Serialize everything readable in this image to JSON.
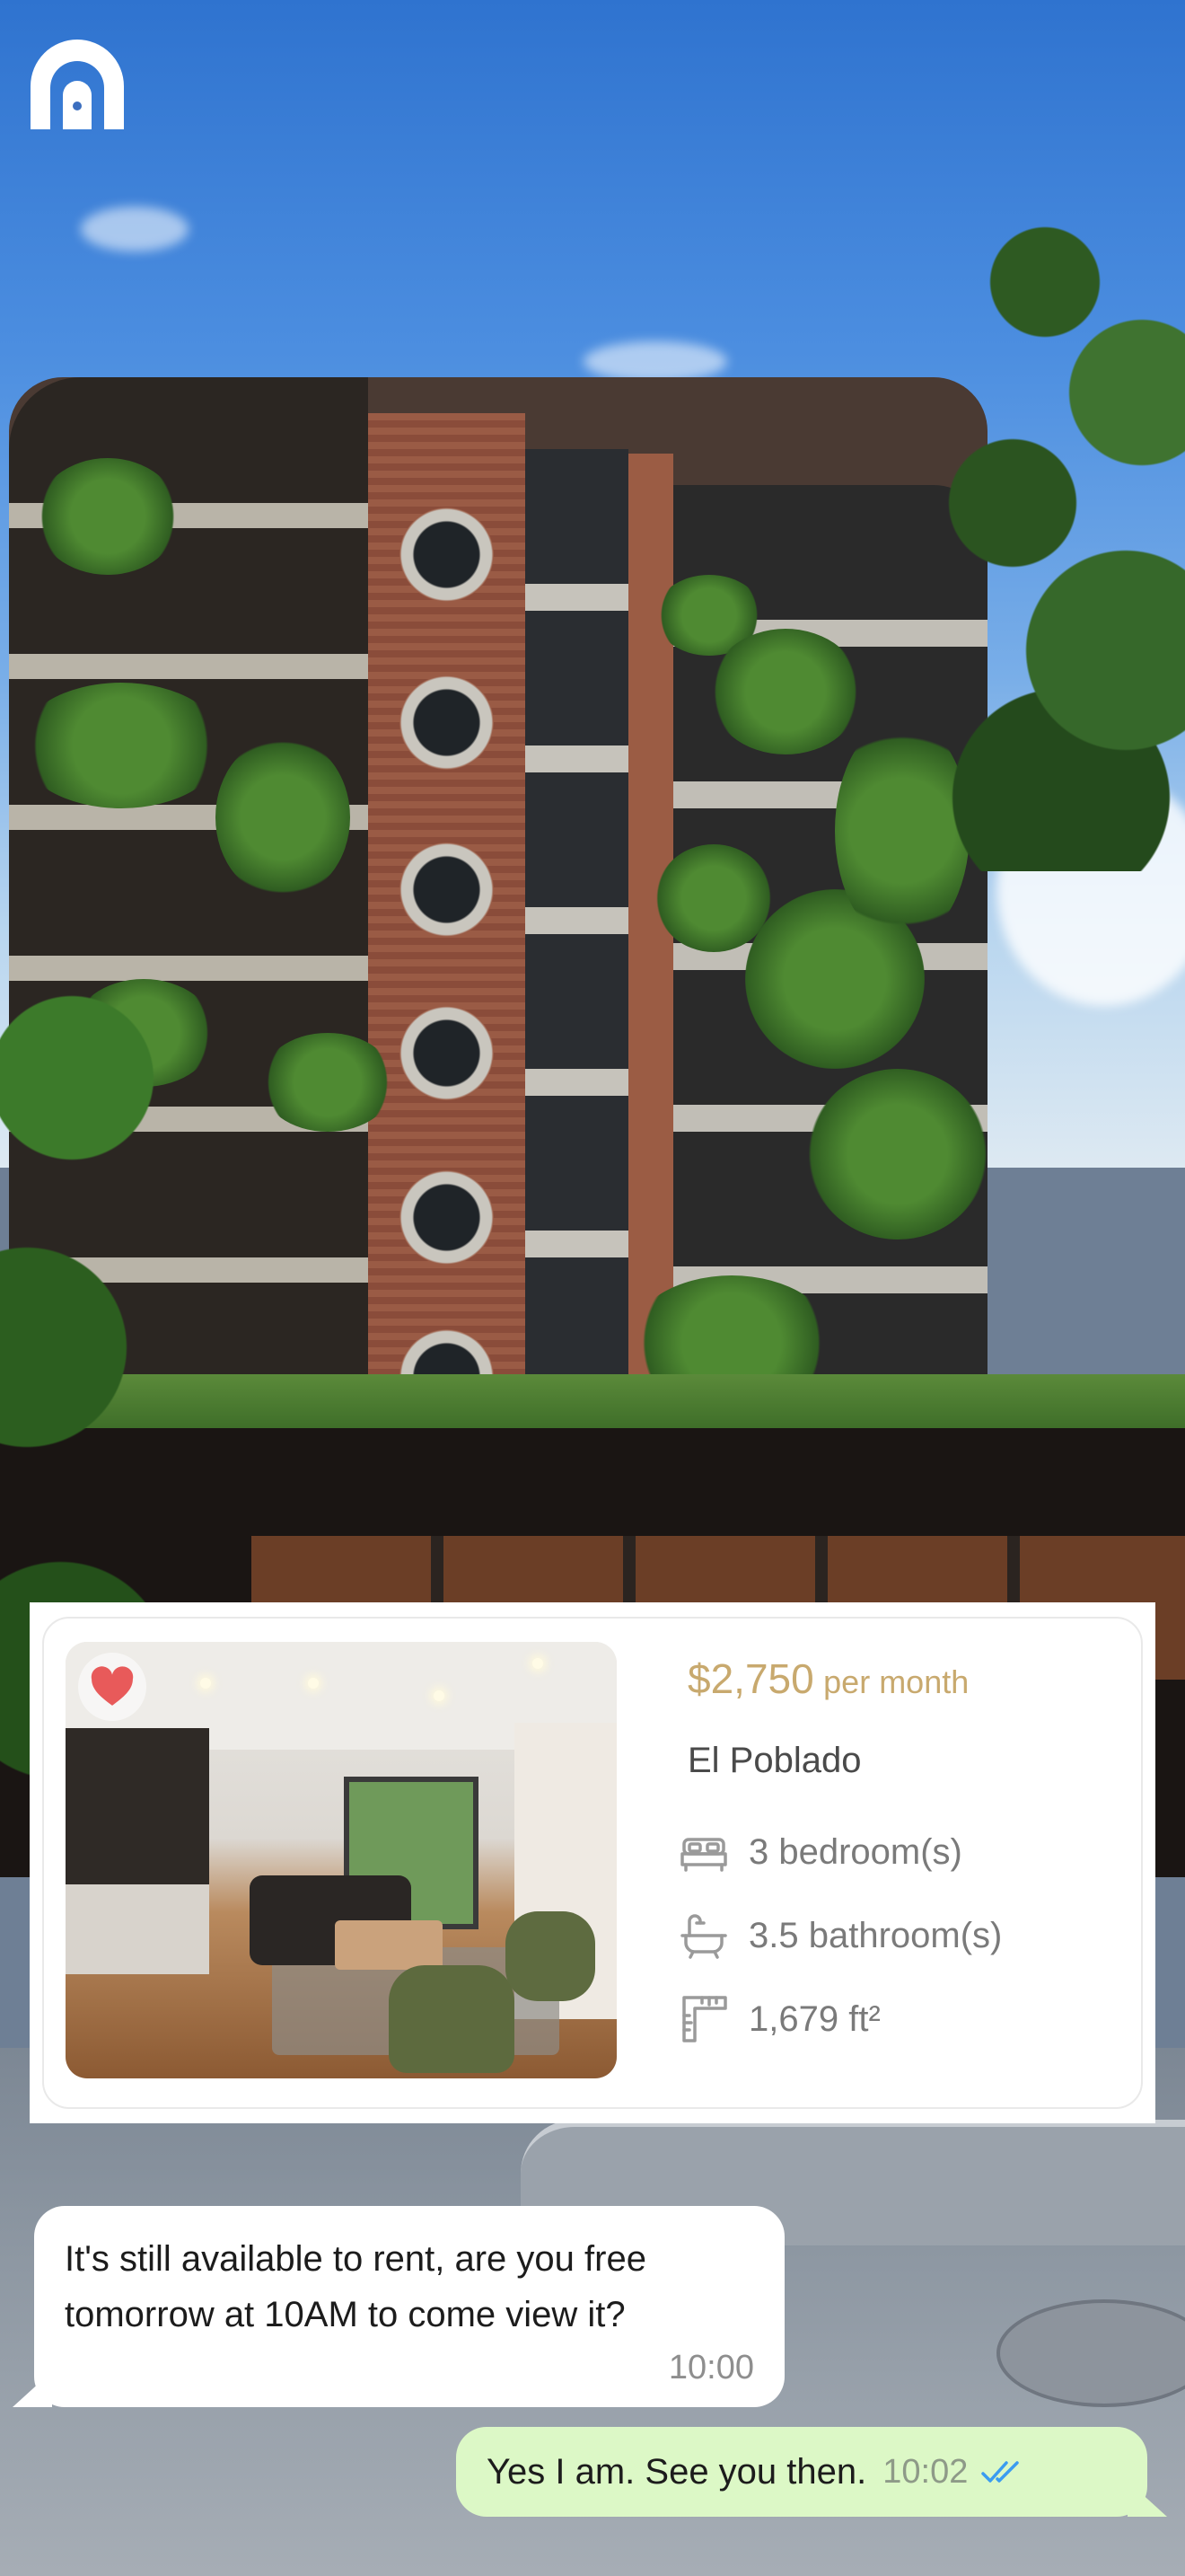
{
  "app": {
    "logo_icon": "arch-door-logo"
  },
  "listing": {
    "price": "$2,750",
    "price_period": "per month",
    "location": "El Poblado",
    "bedrooms": "3 bedroom(s)",
    "bathrooms": "3.5 bathroom(s)",
    "area": "1,679 ft²",
    "favorited": true,
    "icons": {
      "favorite": "heart-icon",
      "bedrooms": "bed-icon",
      "bathrooms": "bathtub-icon",
      "area": "ruler-icon"
    }
  },
  "chat": {
    "messages": [
      {
        "direction": "incoming",
        "text": "It's still available to rent, are you free tomorrow at 10AM to come view it?",
        "time": "10:00"
      },
      {
        "direction": "outgoing",
        "text": "Yes I am. See you then.",
        "time": "10:02",
        "status": "read",
        "status_icon": "double-check-icon"
      }
    ]
  },
  "colors": {
    "price": "#c8a96e",
    "heart": "#e85a5a",
    "outgoing_bubble": "#dcf8c6",
    "read_ticks": "#3b9cf0"
  }
}
